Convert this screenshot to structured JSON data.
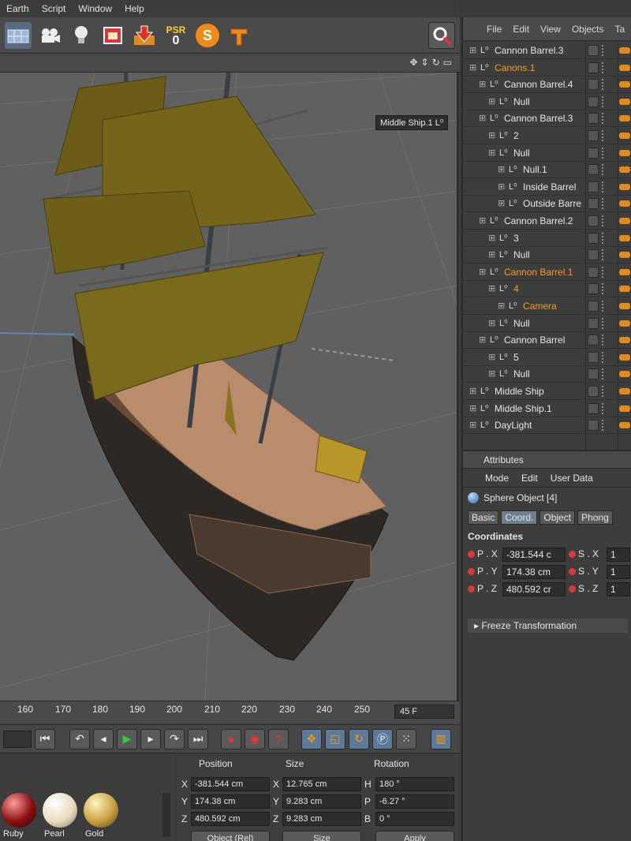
{
  "menubar": {
    "items": [
      "Earth",
      "Script",
      "Window",
      "Help"
    ]
  },
  "toolbar": {
    "psr_label": "PSR",
    "psr_value": "0",
    "s_label": "S"
  },
  "viewport": {
    "object_label": "Middle Ship.1"
  },
  "timeline": {
    "ticks": [
      "160",
      "170",
      "180",
      "190",
      "200",
      "210",
      "220",
      "230",
      "240",
      "250"
    ],
    "frame": "45 F"
  },
  "materials": [
    {
      "name": "Ruby",
      "color": "#8a1010"
    },
    {
      "name": "Pearl",
      "color": "#e8dcc0"
    },
    {
      "name": "Gold",
      "color": "#c8a040"
    }
  ],
  "coords": {
    "headers": {
      "position": "Position",
      "size": "Size",
      "rotation": "Rotation"
    },
    "rows": [
      {
        "axis": "X",
        "pos": "-381.544 cm",
        "size_axis": "X",
        "size": "12.765 cm",
        "rot_axis": "H",
        "rot": "180 °"
      },
      {
        "axis": "Y",
        "pos": "174.38 cm",
        "size_axis": "Y",
        "size": "9.283 cm",
        "rot_axis": "P",
        "rot": "-6.27 °"
      },
      {
        "axis": "Z",
        "pos": "480.592 cm",
        "size_axis": "Z",
        "size": "9.283 cm",
        "rot_axis": "B",
        "rot": "0 °"
      }
    ],
    "mode": "Object (Rel)",
    "size_mode": "Size",
    "apply": "Apply"
  },
  "objects": {
    "menu": [
      "File",
      "Edit",
      "View",
      "Objects",
      "Ta"
    ],
    "rows": [
      {
        "name": "Cannon Barrel.3",
        "indent": 0,
        "orange": false
      },
      {
        "name": "Canons.1",
        "indent": 0,
        "orange": true
      },
      {
        "name": "Cannon Barrel.4",
        "indent": 1,
        "orange": false
      },
      {
        "name": "Null",
        "indent": 2,
        "orange": false
      },
      {
        "name": "Cannon Barrel.3",
        "indent": 1,
        "orange": false
      },
      {
        "name": "2",
        "indent": 2,
        "orange": false
      },
      {
        "name": "Null",
        "indent": 2,
        "orange": false
      },
      {
        "name": "Null.1",
        "indent": 3,
        "orange": false
      },
      {
        "name": "Inside Barrel",
        "indent": 3,
        "orange": false
      },
      {
        "name": "Outside Barre",
        "indent": 3,
        "orange": false
      },
      {
        "name": "Cannon Barrel.2",
        "indent": 1,
        "orange": false
      },
      {
        "name": "3",
        "indent": 2,
        "orange": false
      },
      {
        "name": "Null",
        "indent": 2,
        "orange": false
      },
      {
        "name": "Cannon Barrel.1",
        "indent": 1,
        "orange": true
      },
      {
        "name": "4",
        "indent": 2,
        "orange": true
      },
      {
        "name": "Camera",
        "indent": 3,
        "orange": true
      },
      {
        "name": "Null",
        "indent": 2,
        "orange": false
      },
      {
        "name": "Cannon Barrel",
        "indent": 1,
        "orange": false
      },
      {
        "name": "5",
        "indent": 2,
        "orange": false
      },
      {
        "name": "Null",
        "indent": 2,
        "orange": false
      },
      {
        "name": "Middle Ship",
        "indent": 0,
        "orange": false
      },
      {
        "name": "Middle Ship.1",
        "indent": 0,
        "orange": false
      },
      {
        "name": "DayLight",
        "indent": 0,
        "orange": false
      }
    ]
  },
  "attributes": {
    "title": "Attributes",
    "menu": [
      "Mode",
      "Edit",
      "User Data"
    ],
    "object": "Sphere Object [4]",
    "tabs": [
      "Basic",
      "Coord.",
      "Object",
      "Phong"
    ],
    "active_tab": "Coord.",
    "section": "Coordinates",
    "rows": [
      {
        "p_label": "P . X",
        "p_value": "-381.544 c",
        "s_label": "S . X",
        "s_value": "1"
      },
      {
        "p_label": "P . Y",
        "p_value": "174.38 cm",
        "s_label": "S . Y",
        "s_value": "1"
      },
      {
        "p_label": "P . Z",
        "p_value": "480.592 cr",
        "s_label": "S . Z",
        "s_value": "1"
      }
    ],
    "freeze": "Freeze Transformation"
  }
}
